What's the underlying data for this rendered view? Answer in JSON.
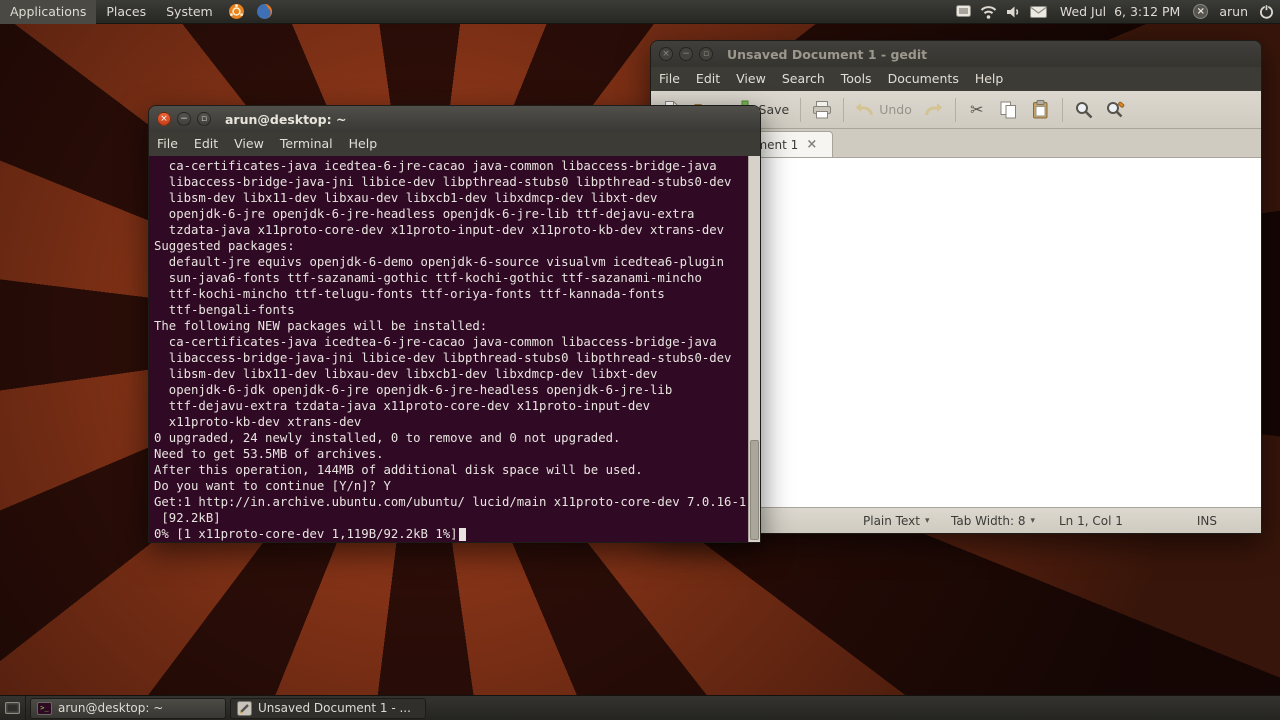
{
  "top_panel": {
    "menus": [
      "Applications",
      "Places",
      "System"
    ],
    "clock": "Wed Jul  6, 3:12 PM",
    "username": "arun"
  },
  "terminal": {
    "title": "arun@desktop: ~",
    "menu": [
      "File",
      "Edit",
      "View",
      "Terminal",
      "Help"
    ],
    "lines": [
      "  ca-certificates-java icedtea-6-jre-cacao java-common libaccess-bridge-java",
      "  libaccess-bridge-java-jni libice-dev libpthread-stubs0 libpthread-stubs0-dev",
      "  libsm-dev libx11-dev libxau-dev libxcb1-dev libxdmcp-dev libxt-dev",
      "  openjdk-6-jre openjdk-6-jre-headless openjdk-6-jre-lib ttf-dejavu-extra",
      "  tzdata-java x11proto-core-dev x11proto-input-dev x11proto-kb-dev xtrans-dev",
      "Suggested packages:",
      "  default-jre equivs openjdk-6-demo openjdk-6-source visualvm icedtea6-plugin",
      "  sun-java6-fonts ttf-sazanami-gothic ttf-kochi-gothic ttf-sazanami-mincho",
      "  ttf-kochi-mincho ttf-telugu-fonts ttf-oriya-fonts ttf-kannada-fonts",
      "  ttf-bengali-fonts",
      "The following NEW packages will be installed:",
      "  ca-certificates-java icedtea-6-jre-cacao java-common libaccess-bridge-java",
      "  libaccess-bridge-java-jni libice-dev libpthread-stubs0 libpthread-stubs0-dev",
      "  libsm-dev libx11-dev libxau-dev libxcb1-dev libxdmcp-dev libxt-dev",
      "  openjdk-6-jdk openjdk-6-jre openjdk-6-jre-headless openjdk-6-jre-lib",
      "  ttf-dejavu-extra tzdata-java x11proto-core-dev x11proto-input-dev",
      "  x11proto-kb-dev xtrans-dev",
      "0 upgraded, 24 newly installed, 0 to remove and 0 not upgraded.",
      "Need to get 53.5MB of archives.",
      "After this operation, 144MB of additional disk space will be used.",
      "Do you want to continue [Y/n]? Y",
      "Get:1 http://in.archive.ubuntu.com/ubuntu/ lucid/main x11proto-core-dev 7.0.16-1",
      " [92.2kB]",
      "0% [1 x11proto-core-dev 1,119B/92.2kB 1%]"
    ]
  },
  "gedit": {
    "title": "Unsaved Document 1 - gedit",
    "menu": [
      "File",
      "Edit",
      "View",
      "Search",
      "Tools",
      "Documents",
      "Help"
    ],
    "toolbar": {
      "save_label": "Save",
      "undo_label": "Undo"
    },
    "tab": {
      "label": "Unsaved Document 1"
    },
    "statusbar": {
      "language": "Plain Text",
      "tab_width": "Tab Width: 8",
      "cursor_position": "Ln 1, Col 1",
      "overwrite_mode": "INS"
    }
  },
  "taskbar": {
    "items": [
      "arun@desktop: ~",
      "Unsaved Document 1 - ..."
    ]
  },
  "icons": {
    "chevron_down": "▾",
    "close_x": "×",
    "minimize": "−",
    "maximize": "▫",
    "cut": "✂",
    "offline_x": "×",
    "terminal_glyph": "&gt;_"
  }
}
